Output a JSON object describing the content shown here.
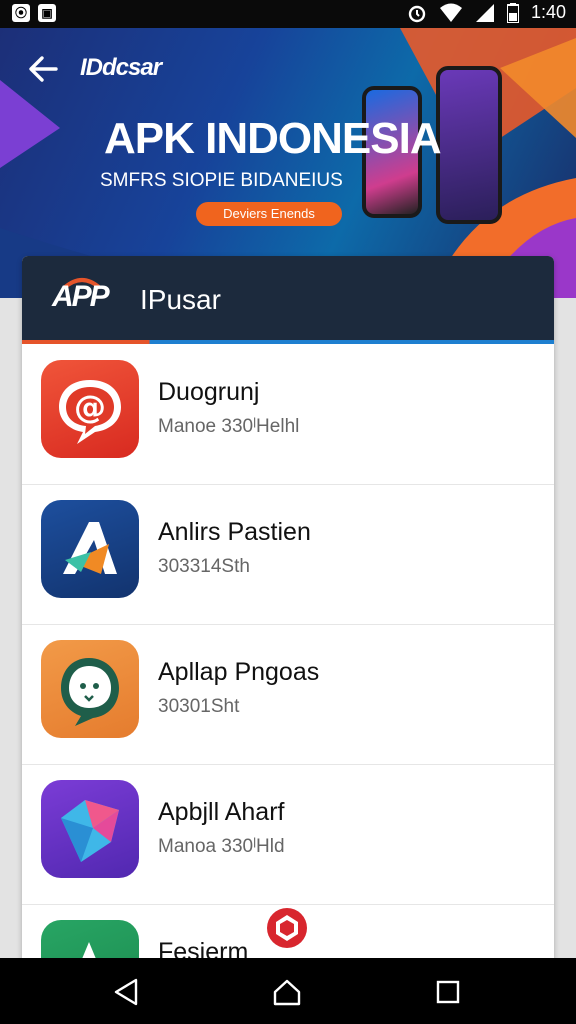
{
  "status_bar": {
    "left_icons": [
      "notification-box-icon",
      "notification-image-icon"
    ],
    "right_icons": [
      "alarm-icon",
      "wifi-icon",
      "signal-icon",
      "battery-icon"
    ],
    "time": "1:40"
  },
  "banner": {
    "brand": "IDdcsar",
    "headline": "APK INDONESIA",
    "subline": "SMFRS SIOPIE BIDANEIUS",
    "cta": "Deviers Enends"
  },
  "list_header": {
    "logo": "APP",
    "title": "IPusar"
  },
  "apps": [
    {
      "name": "Duogrunj",
      "meta": "Manoe 330ˡHelhl",
      "icon": "red-chat-icon"
    },
    {
      "name": "Anlirs Pastien",
      "meta": "303314Sth",
      "icon": "blue-letter-a-icon"
    },
    {
      "name": "Apllap Pngoas",
      "meta": "30301Sht",
      "icon": "orange-ghost-chat-icon"
    },
    {
      "name": "Apbjll Aharf",
      "meta": "Manoa 330ˡHld",
      "icon": "purple-gem-icon"
    },
    {
      "name": "Fesierm",
      "meta": "",
      "icon": "green-letter-a-icon"
    }
  ],
  "colors": {
    "header_bg": "#1c2a3d",
    "accent_orange": "#e5542a",
    "accent_blue": "#1e7fd0",
    "cta": "#f0641e"
  },
  "nav": {
    "icons": [
      "back-triangle-icon",
      "home-icon",
      "recents-square-icon"
    ]
  }
}
